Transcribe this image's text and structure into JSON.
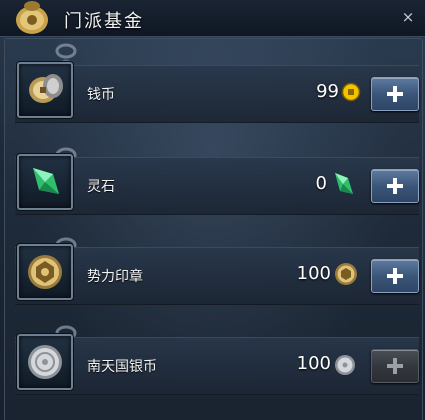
{
  "window": {
    "title": "门派基金",
    "close_label": "×",
    "emblem_icon": "money-bag-icon"
  },
  "rows": [
    {
      "name": "钱币",
      "count": "99",
      "item_icon": "coins-icon",
      "currency_icon": "gold-coin-icon",
      "add_button_enabled": true
    },
    {
      "name": "灵石",
      "count": "0",
      "item_icon": "green-crystal-icon",
      "currency_icon": "green-crystal-icon",
      "add_button_enabled": true
    },
    {
      "name": "势力印章",
      "count": "100",
      "item_icon": "gold-seal-icon",
      "currency_icon": "gold-seal-icon",
      "add_button_enabled": true
    },
    {
      "name": "南天国银币",
      "count": "100",
      "item_icon": "silver-coin-icon",
      "currency_icon": "silver-coin-icon",
      "add_button_enabled": false
    }
  ],
  "colors": {
    "accent_button": "#3b5679",
    "disabled_button": "#34383e",
    "gold": "#d9b24a",
    "crystal": "#3fe08a",
    "silver": "#c9ced4"
  }
}
